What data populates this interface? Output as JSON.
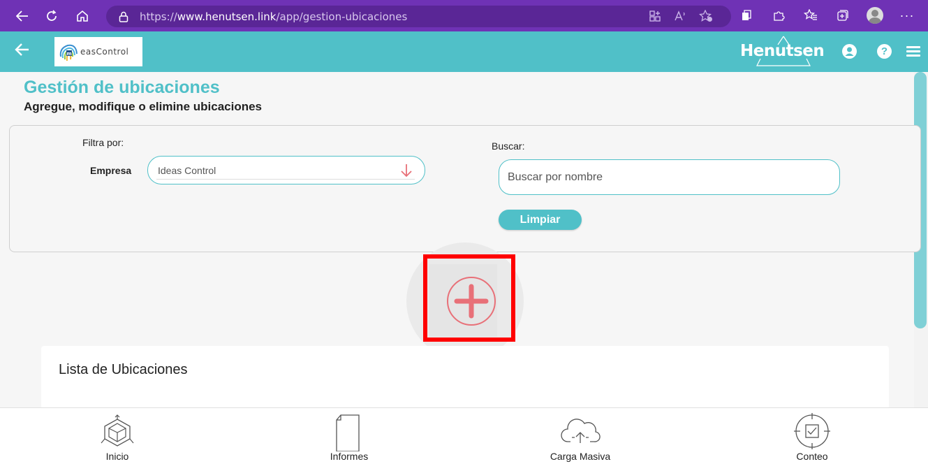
{
  "browser": {
    "url_prefix": "https://",
    "url_domain": "www.henutsen.link",
    "url_path": "/app/gestion-ubicaciones"
  },
  "header": {
    "logo_text": "easControl",
    "brand": "Henutsen",
    "help_symbol": "?"
  },
  "page": {
    "title": "Gestión de ubicaciones",
    "subtitle": "Agregue, modifique o elimine ubicaciones"
  },
  "filters": {
    "filter_label": "Filtra por:",
    "company_label": "Empresa",
    "company_value": "Ideas Control",
    "search_label": "Buscar:",
    "search_placeholder": "Buscar por nombre",
    "clear_button": "Limpiar"
  },
  "list": {
    "title": "Lista de Ubicaciones"
  },
  "bottom_nav": {
    "items": [
      {
        "label": "Inicio",
        "icon": "cube-icon"
      },
      {
        "label": "Informes",
        "icon": "document-icon"
      },
      {
        "label": "Carga Masiva",
        "icon": "cloud-upload-icon"
      },
      {
        "label": "Conteo",
        "icon": "target-check-icon"
      }
    ]
  },
  "colors": {
    "browser": "#6f32b5",
    "accent": "#50c0c8",
    "add_icon": "#e87078",
    "highlight": "#ff0000"
  }
}
